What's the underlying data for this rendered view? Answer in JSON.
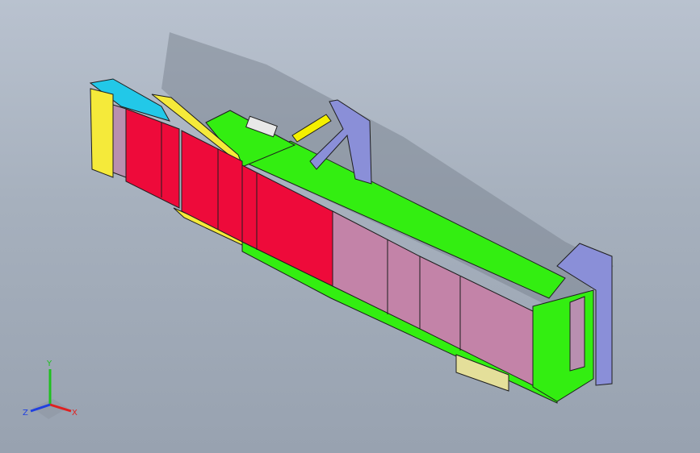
{
  "viewport": {
    "background_top": "#b9c2cf",
    "background_bottom": "#98a2b0"
  },
  "model": {
    "colors": {
      "frame_green": "#33ee11",
      "belt_red": "#ee0a3a",
      "belt_pink": "#c383a8",
      "rail_yellow": "#f5ea3a",
      "roller_pink": "#b98fb0",
      "end_cyan": "#22c8e8",
      "bracket_blue": "#8a8fd8",
      "cylinder_yellow": "#f4f000",
      "edge": "#1e1e1e"
    },
    "icons": [
      "mount-bracket-icon",
      "air-cylinder-icon",
      "drive-roller-icon"
    ]
  },
  "triad": {
    "x_label": "X",
    "y_label": "Y",
    "z_label": "Z",
    "x_color": "#e02020",
    "y_color": "#20c020",
    "z_color": "#2040e0"
  }
}
